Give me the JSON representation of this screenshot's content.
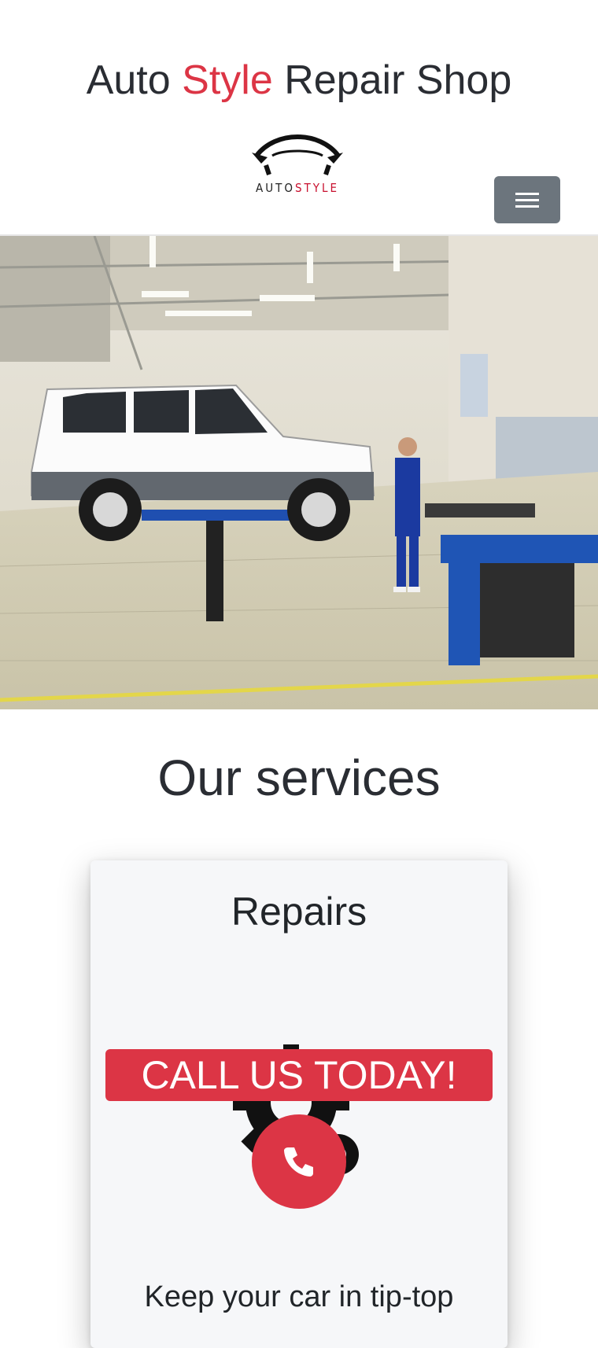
{
  "header": {
    "title_part1": "Auto",
    "title_accent": "Style",
    "title_part2": "Repair Shop",
    "logo": {
      "prefix": "AUTO",
      "suffix": "STYLE"
    },
    "menu_icon": "hamburger-menu-icon"
  },
  "hero": {
    "image": "car-on-lift-in-garage"
  },
  "services": {
    "heading": "Our services",
    "cards": [
      {
        "title": "Repairs",
        "icon": "gear-icon",
        "text": "Keep your car in tip-top"
      }
    ]
  },
  "cta": {
    "label": "CALL US TODAY!",
    "icon": "phone-icon"
  },
  "colors": {
    "accent": "#dc3545",
    "menu_button": "#6c757d",
    "card_bg": "#f6f7f9",
    "text": "#212529"
  }
}
